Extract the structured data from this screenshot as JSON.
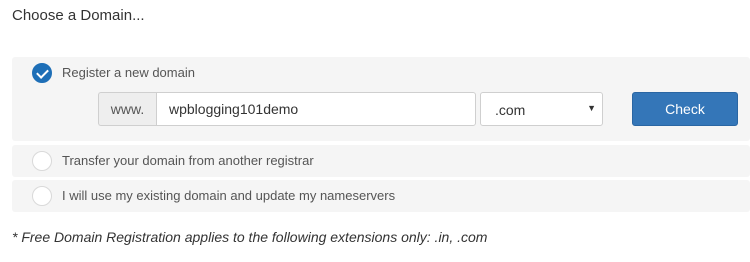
{
  "title": "Choose a Domain...",
  "options": [
    {
      "label": "Register a new domain",
      "selected": true
    },
    {
      "label": "Transfer your domain from another registrar",
      "selected": false
    },
    {
      "label": "I will use my existing domain and update my nameservers",
      "selected": false
    }
  ],
  "register": {
    "prefix": "www.",
    "domain_value": "wpblogging101demo",
    "tld_selected": ".com",
    "check_label": "Check"
  },
  "footnote": "* Free Domain Registration applies to the following extensions only: .in, .com",
  "colors": {
    "accent": "#1e6fb7",
    "button": "#3476b8",
    "panel": "#f5f5f5"
  },
  "icons": {
    "selected": "check-icon",
    "dropdown": "chevron-down-icon"
  }
}
